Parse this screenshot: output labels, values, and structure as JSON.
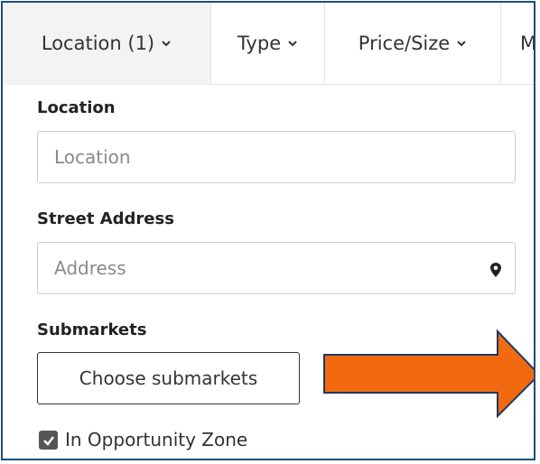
{
  "tabs": [
    {
      "label": "Location (1)",
      "active": true
    },
    {
      "label": "Type",
      "active": false
    },
    {
      "label": "Price/Size",
      "active": false
    },
    {
      "label": "M",
      "active": false
    }
  ],
  "location": {
    "label": "Location",
    "placeholder": "Location"
  },
  "street_address": {
    "label": "Street Address",
    "placeholder": "Address",
    "icon": "map-pin-icon"
  },
  "submarkets": {
    "label": "Submarkets",
    "button_label": "Choose submarkets"
  },
  "opportunity_zone": {
    "label": "In Opportunity Zone",
    "checked": true
  },
  "colors": {
    "frame_border": "#1f4e79",
    "arrow_fill": "#f26a10",
    "arrow_stroke": "#1f3864",
    "checkbox": "#555555",
    "active_tab": "#f3f3f3"
  }
}
